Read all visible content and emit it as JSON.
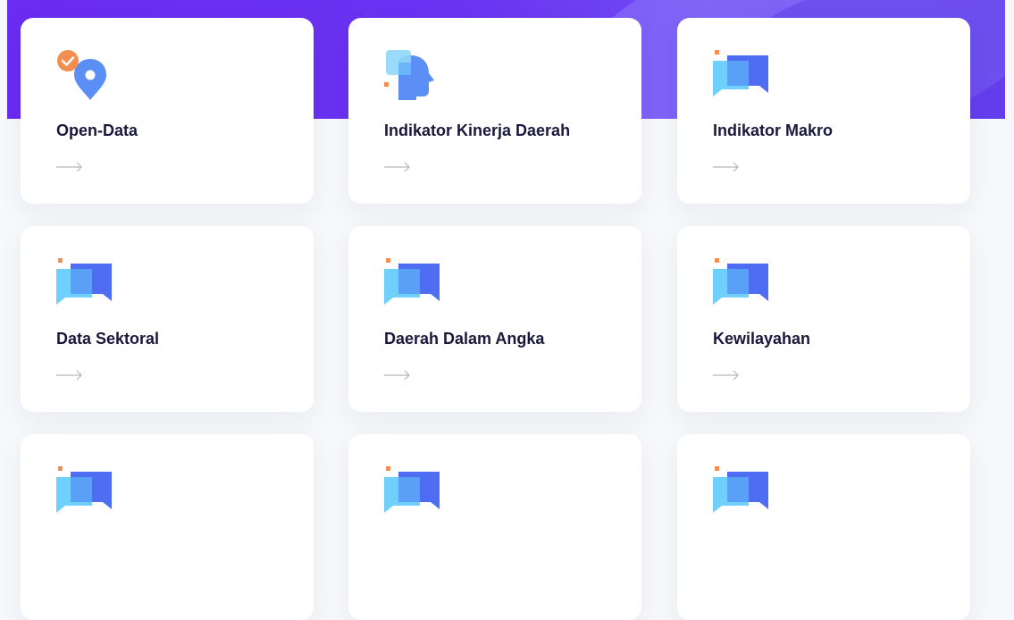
{
  "cards": [
    {
      "title": "Open-Data",
      "icon": "location-check-icon"
    },
    {
      "title": "Indikator Kinerja Daerah",
      "icon": "head-profile-icon"
    },
    {
      "title": "Indikator Makro",
      "icon": "chat-bubbles-icon"
    },
    {
      "title": "Data Sektoral",
      "icon": "chat-bubbles-icon"
    },
    {
      "title": "Daerah Dalam Angka",
      "icon": "chat-bubbles-icon"
    },
    {
      "title": "Kewilayahan",
      "icon": "chat-bubbles-icon"
    },
    {
      "title": "",
      "icon": "chat-bubbles-icon"
    },
    {
      "title": "",
      "icon": "chat-bubbles-icon"
    },
    {
      "title": "",
      "icon": "chat-bubbles-icon"
    }
  ],
  "colors": {
    "hero": "#6a2cf0",
    "title": "#17183b",
    "icon_light": "#6ed0fb",
    "icon_mid": "#5aa0f7",
    "icon_dark": "#4f6df2",
    "icon_accent": "#f48e4f"
  }
}
